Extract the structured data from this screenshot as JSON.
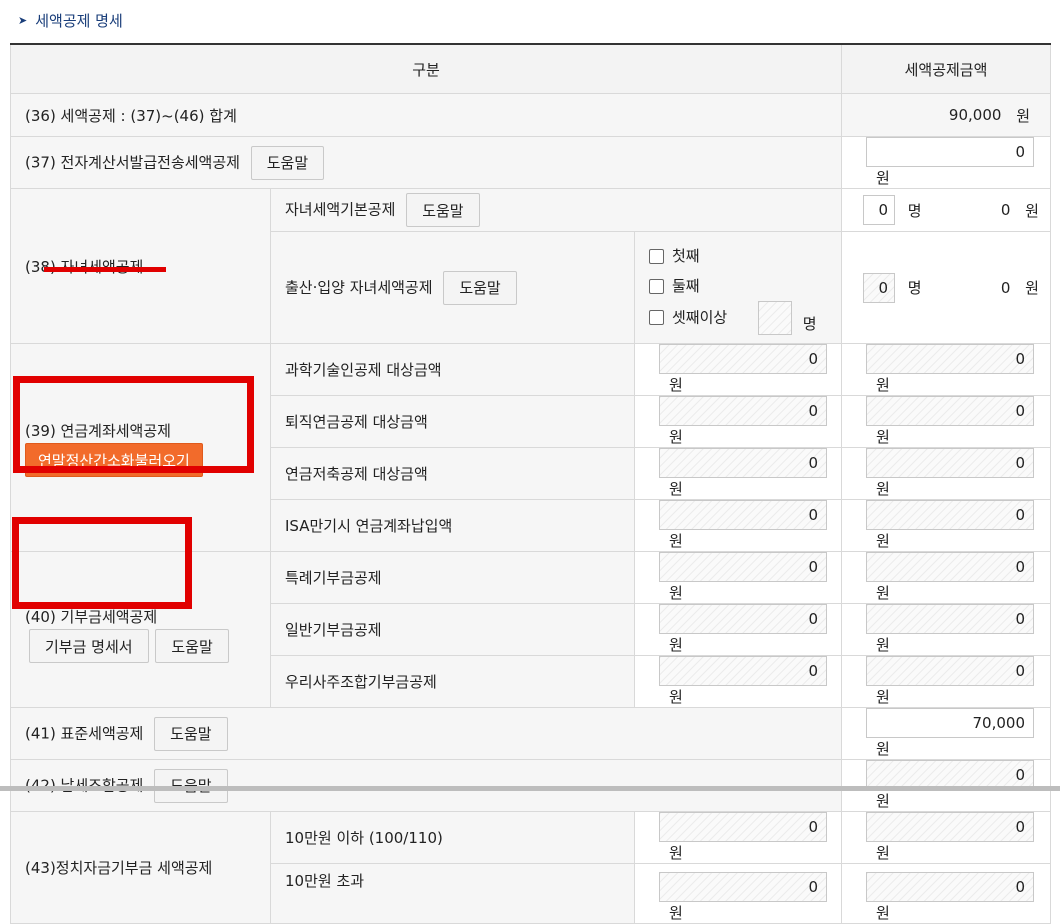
{
  "section": {
    "title": "세액공제 명세",
    "chevron_icon": "chevron-right-icon"
  },
  "header": {
    "col1": "구분",
    "col2": "세액공제금액"
  },
  "unit_won": "원",
  "unit_people": "명",
  "help_label": "도움말",
  "row36": {
    "label": "(36) 세액공제 : (37)~(46) 합계",
    "amount": "90,000"
  },
  "row37": {
    "label": "(37) 전자계산서발급전송세액공제",
    "amount": "0"
  },
  "row38": {
    "label": "(38) 자녀세액공제",
    "basic": {
      "label": "자녀세액기본공제",
      "count": "0",
      "amount": "0"
    },
    "birth": {
      "label": "출산·입양 자녀세액공제",
      "opt1": "첫째",
      "opt2": "둘째",
      "opt3": "셋째이상",
      "count3": "",
      "count": "0",
      "amount": "0"
    }
  },
  "row39": {
    "label": "(39) 연금계좌세액공제",
    "button": "연말정산간소화불러오기",
    "items": [
      {
        "label": "과학기술인공제 대상금액",
        "target": "0",
        "amount": "0"
      },
      {
        "label": "퇴직연금공제 대상금액",
        "target": "0",
        "amount": "0"
      },
      {
        "label": "연금저축공제 대상금액",
        "target": "0",
        "amount": "0"
      },
      {
        "label": "ISA만기시 연금계좌납입액",
        "target": "0",
        "amount": "0"
      }
    ]
  },
  "row40": {
    "label": "(40) 기부금세액공제",
    "detail_button": "기부금 명세서",
    "help_button": "도움말",
    "items": [
      {
        "label": "특례기부금공제",
        "target": "0",
        "amount": "0"
      },
      {
        "label": "일반기부금공제",
        "target": "0",
        "amount": "0"
      },
      {
        "label": "우리사주조합기부금공제",
        "target": "0",
        "amount": "0"
      }
    ]
  },
  "row41": {
    "label": "(41) 표준세액공제",
    "amount": "70,000"
  },
  "row42": {
    "label": "(42) 납세조합공제",
    "amount": "0"
  },
  "row43": {
    "label": "(43)정치자금기부금 세액공제",
    "items": [
      {
        "label": "10만원 이하 (100/110)",
        "target": "0",
        "amount": "0"
      },
      {
        "label": "10만원 초과",
        "target": "0",
        "amount": "0"
      }
    ]
  },
  "colors": {
    "accent_red": "#e10000",
    "orange_button": "#f26b2b",
    "title_blue": "#1a3e7a"
  }
}
